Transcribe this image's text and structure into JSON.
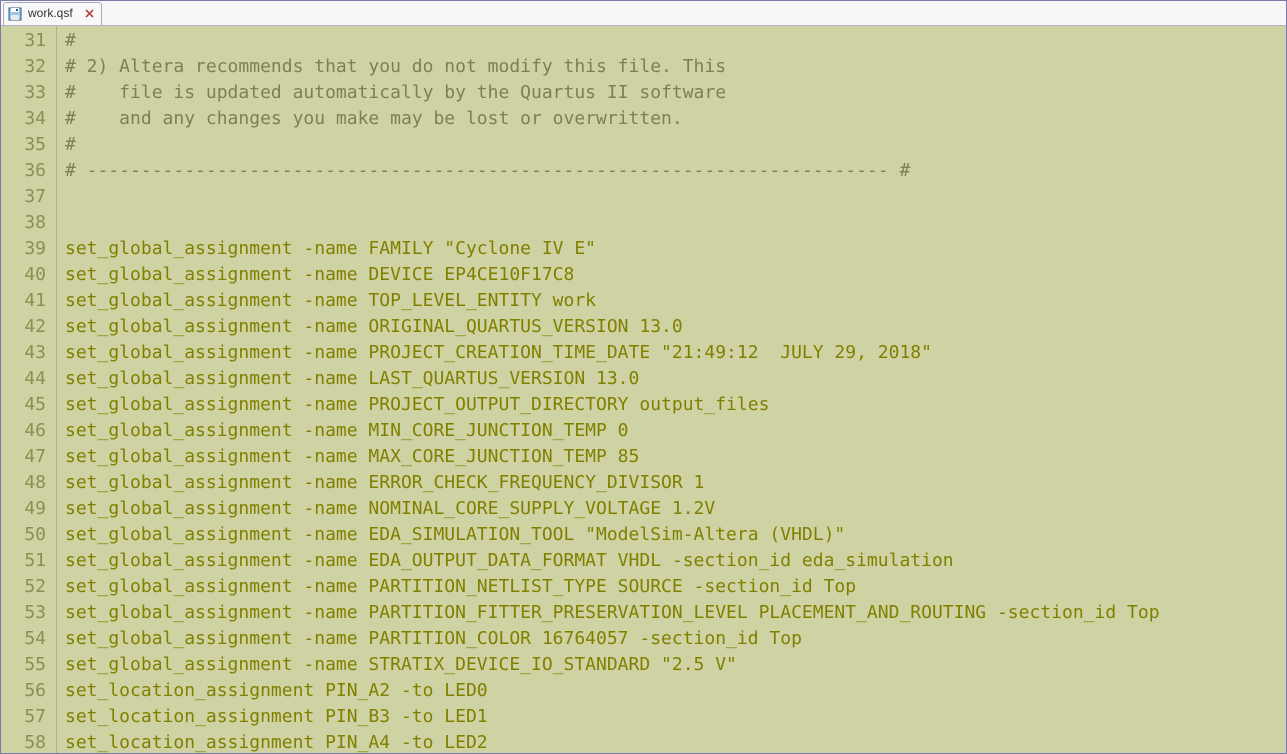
{
  "tab": {
    "filename": "work.qsf"
  },
  "editor": {
    "startLine": 31,
    "lines": [
      {
        "num": 31,
        "text": "#",
        "class": "comment"
      },
      {
        "num": 32,
        "text": "# 2) Altera recommends that you do not modify this file. This",
        "class": "comment"
      },
      {
        "num": 33,
        "text": "#    file is updated automatically by the Quartus II software",
        "class": "comment"
      },
      {
        "num": 34,
        "text": "#    and any changes you make may be lost or overwritten.",
        "class": "comment"
      },
      {
        "num": 35,
        "text": "#",
        "class": "comment"
      },
      {
        "num": 36,
        "text": "# -------------------------------------------------------------------------- #",
        "class": "comment"
      },
      {
        "num": 37,
        "text": "",
        "class": ""
      },
      {
        "num": 38,
        "text": "",
        "class": ""
      },
      {
        "num": 39,
        "text": "set_global_assignment -name FAMILY \"Cyclone IV E\"",
        "class": ""
      },
      {
        "num": 40,
        "text": "set_global_assignment -name DEVICE EP4CE10F17C8",
        "class": ""
      },
      {
        "num": 41,
        "text": "set_global_assignment -name TOP_LEVEL_ENTITY work",
        "class": ""
      },
      {
        "num": 42,
        "text": "set_global_assignment -name ORIGINAL_QUARTUS_VERSION 13.0",
        "class": ""
      },
      {
        "num": 43,
        "text": "set_global_assignment -name PROJECT_CREATION_TIME_DATE \"21:49:12  JULY 29, 2018\"",
        "class": ""
      },
      {
        "num": 44,
        "text": "set_global_assignment -name LAST_QUARTUS_VERSION 13.0",
        "class": ""
      },
      {
        "num": 45,
        "text": "set_global_assignment -name PROJECT_OUTPUT_DIRECTORY output_files",
        "class": ""
      },
      {
        "num": 46,
        "text": "set_global_assignment -name MIN_CORE_JUNCTION_TEMP 0",
        "class": ""
      },
      {
        "num": 47,
        "text": "set_global_assignment -name MAX_CORE_JUNCTION_TEMP 85",
        "class": ""
      },
      {
        "num": 48,
        "text": "set_global_assignment -name ERROR_CHECK_FREQUENCY_DIVISOR 1",
        "class": ""
      },
      {
        "num": 49,
        "text": "set_global_assignment -name NOMINAL_CORE_SUPPLY_VOLTAGE 1.2V",
        "class": ""
      },
      {
        "num": 50,
        "text": "set_global_assignment -name EDA_SIMULATION_TOOL \"ModelSim-Altera (VHDL)\"",
        "class": ""
      },
      {
        "num": 51,
        "text": "set_global_assignment -name EDA_OUTPUT_DATA_FORMAT VHDL -section_id eda_simulation",
        "class": ""
      },
      {
        "num": 52,
        "text": "set_global_assignment -name PARTITION_NETLIST_TYPE SOURCE -section_id Top",
        "class": ""
      },
      {
        "num": 53,
        "text": "set_global_assignment -name PARTITION_FITTER_PRESERVATION_LEVEL PLACEMENT_AND_ROUTING -section_id Top",
        "class": ""
      },
      {
        "num": 54,
        "text": "set_global_assignment -name PARTITION_COLOR 16764057 -section_id Top",
        "class": ""
      },
      {
        "num": 55,
        "text": "set_global_assignment -name STRATIX_DEVICE_IO_STANDARD \"2.5 V\"",
        "class": ""
      },
      {
        "num": 56,
        "text": "set_location_assignment PIN_A2 -to LED0",
        "class": ""
      },
      {
        "num": 57,
        "text": "set_location_assignment PIN_B3 -to LED1",
        "class": ""
      },
      {
        "num": 58,
        "text": "set_location_assignment PIN_A4 -to LED2",
        "class": ""
      }
    ]
  }
}
